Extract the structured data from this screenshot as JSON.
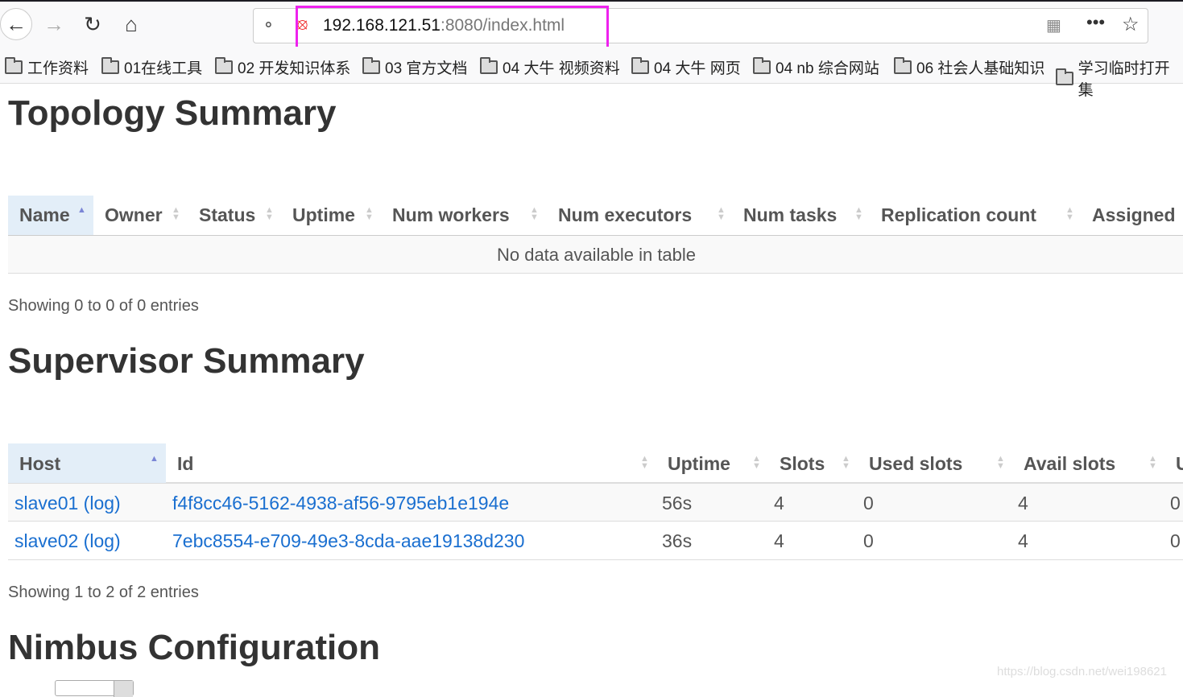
{
  "browser": {
    "url_host": "192.168.121.51",
    "url_rest": ":8080/index.html",
    "bookmarks": [
      "工作资料",
      "01在线工具",
      "02 开发知识体系",
      "03 官方文档",
      "04 大牛 视频资料",
      "04 大牛 网页",
      "04 nb 综合网站",
      "06 社会人基础知识",
      "学习临时打开集"
    ]
  },
  "topology": {
    "title": "Topology Summary",
    "columns": [
      "Name",
      "Owner",
      "Status",
      "Uptime",
      "Num workers",
      "Num executors",
      "Num tasks",
      "Replication count",
      "Assigned"
    ],
    "sorted_column": "Name",
    "empty_message": "No data available in table",
    "info": "Showing 0 to 0 of 0 entries"
  },
  "supervisor": {
    "title": "Supervisor Summary",
    "columns": [
      "Host",
      "Id",
      "Uptime",
      "Slots",
      "Used slots",
      "Avail slots",
      "U"
    ],
    "sorted_column": "Host",
    "rows": [
      {
        "host": "slave01",
        "log": "(log)",
        "id": "f4f8cc46-5162-4938-af56-9795eb1e194e",
        "uptime": "56s",
        "slots": "4",
        "used": "0",
        "avail": "4",
        "extra": "0"
      },
      {
        "host": "slave02",
        "log": "(log)",
        "id": "7ebc8554-e709-49e3-8cda-aae19138d230",
        "uptime": "36s",
        "slots": "4",
        "used": "0",
        "avail": "4",
        "extra": "0"
      }
    ],
    "info": "Showing 1 to 2 of 2 entries"
  },
  "nimbus": {
    "title": "Nimbus Configuration"
  },
  "watermark": "https://blog.csdn.net/wei198621",
  "colors": {
    "link": "#1a6fd0",
    "sorted_header_bg": "#e3eef8",
    "url_highlight": "#ee22ee"
  }
}
